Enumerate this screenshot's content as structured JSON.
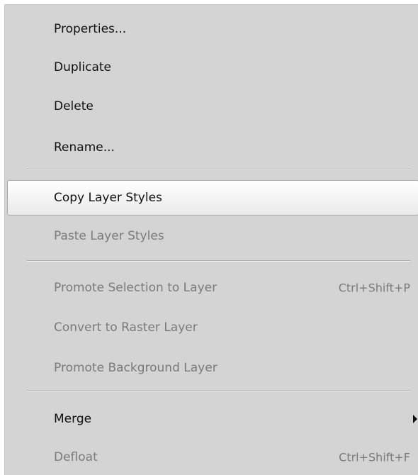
{
  "menu": {
    "items": [
      {
        "label": "Properties...",
        "shortcut": "",
        "enabled": true
      },
      {
        "label": "Duplicate",
        "shortcut": "",
        "enabled": true
      },
      {
        "label": "Delete",
        "shortcut": "",
        "enabled": true
      },
      {
        "label": "Rename...",
        "shortcut": "",
        "enabled": true
      },
      {
        "label": "Copy Layer Styles",
        "shortcut": "",
        "enabled": true,
        "highlighted": true
      },
      {
        "label": "Paste Layer Styles",
        "shortcut": "",
        "enabled": false
      },
      {
        "label": "Promote Selection to Layer",
        "shortcut": "Ctrl+Shift+P",
        "enabled": false
      },
      {
        "label": "Convert to Raster Layer",
        "shortcut": "",
        "enabled": false
      },
      {
        "label": "Promote Background Layer",
        "shortcut": "",
        "enabled": false
      },
      {
        "label": "Merge",
        "shortcut": "",
        "enabled": true,
        "submenu": true
      },
      {
        "label": "Defloat",
        "shortcut": "Ctrl+Shift+F",
        "enabled": false
      }
    ]
  },
  "icons": {
    "submenu": "chevron-right-icon"
  },
  "colors": {
    "menu_background": "#d4d4d4",
    "enabled_text": "#101010",
    "disabled_text": "#7a7a7a",
    "highlight_border": "#a9a9a9"
  }
}
